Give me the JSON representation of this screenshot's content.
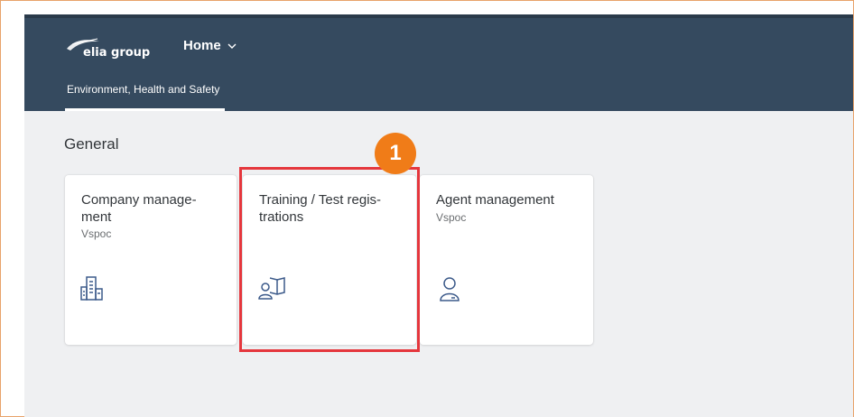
{
  "header": {
    "logo_text": "elia group",
    "home_label": "Home",
    "tab_label": "Environment, Health and Safety"
  },
  "section": {
    "title": "General"
  },
  "tiles": [
    {
      "title": "Company manage-ment",
      "title_line1": "Company manage-",
      "title_line2": "ment",
      "subtitle": "Vspoc",
      "icon": "building-icon"
    },
    {
      "title": "Training / Test regis-trations",
      "title_line1": "Training / Test regis-",
      "title_line2": "trations",
      "subtitle": "",
      "icon": "person-book-icon"
    },
    {
      "title": "Agent management",
      "title_line1": "Agent management",
      "subtitle": "Vspoc",
      "icon": "person-icon"
    }
  ],
  "annotation": {
    "step_number": "1",
    "highlight_color": "#e5373d",
    "badge_color": "#f07c18"
  },
  "colors": {
    "shell_bar": "#354a5f",
    "page_background": "#eff0f2"
  }
}
